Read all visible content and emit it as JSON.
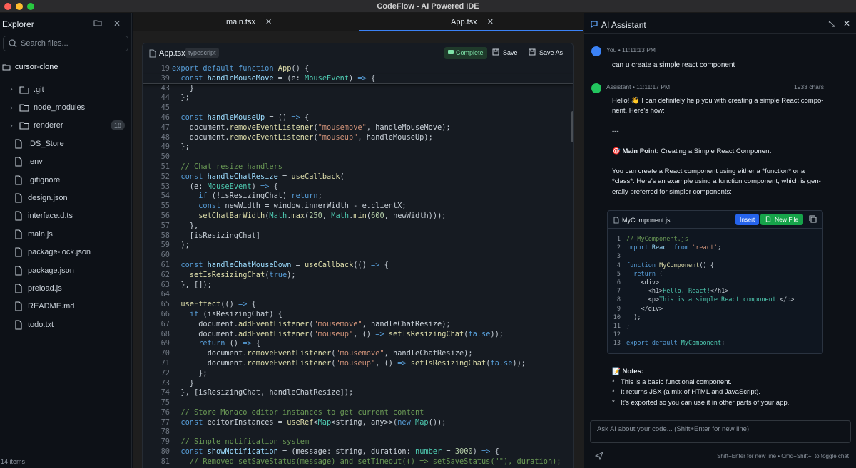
{
  "app": {
    "title": "CodeFlow - AI Powered IDE"
  },
  "explorer": {
    "title": "Explorer",
    "search_placeholder": "Search files...",
    "root": "cursor-clone",
    "items": [
      {
        "name": ".git",
        "type": "folder"
      },
      {
        "name": "node_modules",
        "type": "folder"
      },
      {
        "name": "renderer",
        "type": "folder",
        "badge": "18"
      },
      {
        "name": ".DS_Store",
        "type": "file"
      },
      {
        "name": ".env",
        "type": "file"
      },
      {
        "name": ".gitignore",
        "type": "file"
      },
      {
        "name": "design.json",
        "type": "file"
      },
      {
        "name": "interface.d.ts",
        "type": "file"
      },
      {
        "name": "main.js",
        "type": "file"
      },
      {
        "name": "package-lock.json",
        "type": "file"
      },
      {
        "name": "package.json",
        "type": "file"
      },
      {
        "name": "preload.js",
        "type": "file"
      },
      {
        "name": "README.md",
        "type": "file"
      },
      {
        "name": "todo.txt",
        "type": "file"
      }
    ],
    "footer": "14 items"
  },
  "tabs": [
    {
      "label": "main.tsx",
      "active": false
    },
    {
      "label": "App.tsx",
      "active": true
    }
  ],
  "editor": {
    "filename": "App.tsx",
    "language": "typescript",
    "complete_label": "Complete",
    "save_label": "Save",
    "save_as_label": "Save As",
    "lines": [
      {
        "n": "19",
        "html": "<span class='k'>export default function</span> <span class='f'>App</span>() {"
      },
      {
        "n": "39",
        "html": "  <span class='k'>const</span> <span class='v'>handleMouseMove</span> = (e: <span class='t'>MouseEvent</span>) <span class='k'>=&gt;</span> {"
      },
      {
        "n": "43",
        "html": "    }"
      },
      {
        "n": "44",
        "html": "  };"
      },
      {
        "n": "45",
        "html": ""
      },
      {
        "n": "46",
        "html": "  <span class='k'>const</span> <span class='v'>handleMouseUp</span> = () <span class='k'>=&gt;</span> {"
      },
      {
        "n": "47",
        "html": "    document.<span class='f'>removeEventListener</span>(<span class='s'>\"mousemove\"</span>, handleMouseMove);"
      },
      {
        "n": "48",
        "html": "    document.<span class='f'>removeEventListener</span>(<span class='s'>\"mouseup\"</span>, handleMouseUp);"
      },
      {
        "n": "49",
        "html": "  };"
      },
      {
        "n": "50",
        "html": ""
      },
      {
        "n": "51",
        "html": "  <span class='c'>// Chat resize handlers</span>"
      },
      {
        "n": "52",
        "html": "  <span class='k'>const</span> <span class='v'>handleChatResize</span> = <span class='f'>useCallback</span>("
      },
      {
        "n": "53",
        "html": "    (e: <span class='t'>MouseEvent</span>) <span class='k'>=&gt;</span> {"
      },
      {
        "n": "54",
        "html": "      <span class='k'>if</span> (!isResizingChat) <span class='k'>return</span>;"
      },
      {
        "n": "55",
        "html": "      <span class='k'>const</span> newWidth = window.innerWidth - e.clientX;"
      },
      {
        "n": "56",
        "html": "      <span class='f'>setChatBarWidth</span>(<span class='t'>Math</span>.<span class='f'>max</span>(<span class='n'>250</span>, <span class='t'>Math</span>.<span class='f'>min</span>(<span class='n'>600</span>, newWidth)));"
      },
      {
        "n": "57",
        "html": "    },"
      },
      {
        "n": "58",
        "html": "    [isResizingChat]"
      },
      {
        "n": "59",
        "html": "  );"
      },
      {
        "n": "60",
        "html": ""
      },
      {
        "n": "61",
        "html": "  <span class='k'>const</span> <span class='v'>handleChatMouseDown</span> = <span class='f'>useCallback</span>(() <span class='k'>=&gt;</span> {"
      },
      {
        "n": "62",
        "html": "    <span class='f'>setIsResizingChat</span>(<span class='k'>true</span>);"
      },
      {
        "n": "63",
        "html": "  }, []);"
      },
      {
        "n": "64",
        "html": ""
      },
      {
        "n": "65",
        "html": "  <span class='f'>useEffect</span>(() <span class='k'>=&gt;</span> {"
      },
      {
        "n": "66",
        "html": "    <span class='k'>if</span> (isResizingChat) {"
      },
      {
        "n": "67",
        "html": "      document.<span class='f'>addEventListener</span>(<span class='s'>\"mousemove\"</span>, handleChatResize);"
      },
      {
        "n": "68",
        "html": "      document.<span class='f'>addEventListener</span>(<span class='s'>\"mouseup\"</span>, () <span class='k'>=&gt;</span> <span class='f'>setIsResizingChat</span>(<span class='k'>false</span>));"
      },
      {
        "n": "69",
        "html": "      <span class='k'>return</span> () <span class='k'>=&gt;</span> {"
      },
      {
        "n": "70",
        "html": "        document.<span class='f'>removeEventListener</span>(<span class='s'>\"mousemove\"</span>, handleChatResize);"
      },
      {
        "n": "71",
        "html": "        document.<span class='f'>removeEventListener</span>(<span class='s'>\"mouseup\"</span>, () <span class='k'>=&gt;</span> <span class='f'>setIsResizingChat</span>(<span class='k'>false</span>));"
      },
      {
        "n": "72",
        "html": "      };"
      },
      {
        "n": "73",
        "html": "    }"
      },
      {
        "n": "74",
        "html": "  }, [isResizingChat, handleChatResize]);"
      },
      {
        "n": "75",
        "html": ""
      },
      {
        "n": "76",
        "html": "  <span class='c'>// Store Monaco editor instances to get current content</span>"
      },
      {
        "n": "77",
        "html": "  <span class='k'>const</span> editorInstances = <span class='f'>useRef</span>&lt;<span class='t'>Map</span>&lt;string, any&gt;&gt;(<span class='k'>new</span> <span class='t'>Map</span>());"
      },
      {
        "n": "78",
        "html": ""
      },
      {
        "n": "79",
        "html": "  <span class='c'>// Simple notification system</span>"
      },
      {
        "n": "80",
        "html": "  <span class='k'>const</span> <span class='v'>showNotification</span> = (message: string, duration: <span class='t'>number</span> = <span class='n'>3000</span>) <span class='k'>=&gt;</span> {"
      },
      {
        "n": "81",
        "html": "    <span class='c'>// Removed setSaveStatus(message) and setTimeout(() =&gt; setSaveStatus(\"\"), duration);</span>"
      }
    ]
  },
  "ai": {
    "title": "AI Assistant",
    "user_meta": "You • 11:11:13 PM",
    "user_text": "can u create a simple react component",
    "assistant_meta": "Assistant • 11:11:17 PM",
    "chars": "1933 chars",
    "intro": "Hello! 👋 I can definitely help you with creating a simple React compo-nent. Here's how:",
    "separator": "---",
    "main_point_label": "🎯 Main Point:",
    "main_point_text": " Creating a Simple React Component",
    "paragraph": "You can create a React component using either a *function* or a *class*. Here's an example using a function component, which is gen-erally preferred for simpler components:",
    "code_file": "MyComponent.js",
    "insert_label": "Insert",
    "new_file_label": "New File",
    "code_lines": [
      {
        "n": "1",
        "html": "<span class='c'>// MyComponent.js</span>"
      },
      {
        "n": "2",
        "html": "<span class='k'>import</span> <span class='v'>React</span> <span class='k'>from</span> <span class='s'>'react'</span>;"
      },
      {
        "n": "3",
        "html": ""
      },
      {
        "n": "4",
        "html": "<span class='k'>function</span> <span class='f'>MyComponent</span>() {"
      },
      {
        "n": "5",
        "html": "  <span class='k'>return</span> ("
      },
      {
        "n": "6",
        "html": "    &lt;div&gt;"
      },
      {
        "n": "7",
        "html": "      &lt;h1&gt;<span class='t'>Hello, React!</span>&lt;/h1&gt;"
      },
      {
        "n": "8",
        "html": "      &lt;p&gt;<span class='t'>This is a simple React component.</span>&lt;/p&gt;"
      },
      {
        "n": "9",
        "html": "    &lt;/div&gt;"
      },
      {
        "n": "10",
        "html": "  );"
      },
      {
        "n": "11",
        "html": "}"
      },
      {
        "n": "12",
        "html": ""
      },
      {
        "n": "13",
        "html": "<span class='k'>export default</span> <span class='t'>MyComponent</span>;"
      }
    ],
    "notes_title": "📝 Notes:",
    "notes": [
      "This is a basic functional component.",
      "It returns JSX (a mix of HTML and JavaScript).",
      "It's exported so you can use it in other parts of your app."
    ],
    "input_placeholder": "Ask AI about your code... (Shift+Enter for new line)",
    "hint": "Shift+Enter for new line • Cmd+Shift+I to toggle chat"
  },
  "colors": {
    "accent": "#3b82f6",
    "success": "#16a34a",
    "marker": "#d0312d"
  }
}
